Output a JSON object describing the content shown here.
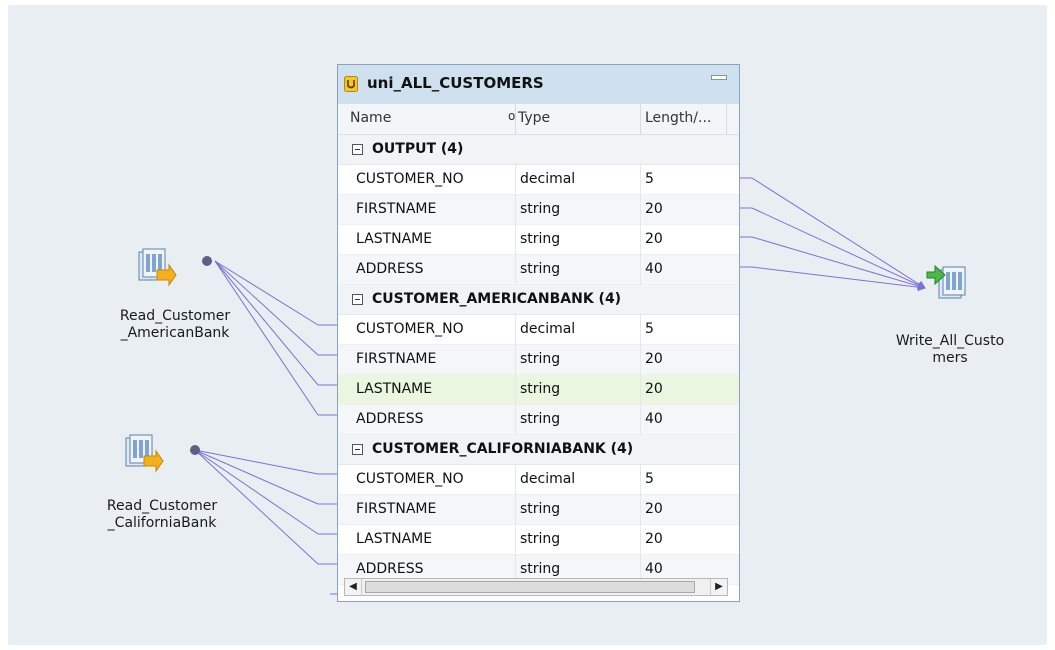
{
  "canvas": {
    "background": "#e9eef2",
    "link_color": "#7b72d8"
  },
  "sources": [
    {
      "label": "Read_Customer\n_AmericanBank",
      "icon": "read-data-object-icon"
    },
    {
      "label": "Read_Customer\n_CaliforniaBank",
      "icon": "read-data-object-icon"
    }
  ],
  "target": {
    "label": "Write_All_Custo\nmers",
    "icon": "write-data-object-icon"
  },
  "transformation": {
    "title": "uni_ALL_CUSTOMERS",
    "icon": "union-transformation-icon",
    "columns": [
      "Name",
      "Type",
      "Length/..."
    ],
    "groups": [
      {
        "name": "OUTPUT (4)",
        "rows": [
          {
            "name": "CUSTOMER_NO",
            "type": "decimal",
            "length": "5"
          },
          {
            "name": "FIRSTNAME",
            "type": "string",
            "length": "20"
          },
          {
            "name": "LASTNAME",
            "type": "string",
            "length": "20"
          },
          {
            "name": "ADDRESS",
            "type": "string",
            "length": "40"
          }
        ]
      },
      {
        "name": "CUSTOMER_AMERICANBANK (4)",
        "rows": [
          {
            "name": "CUSTOMER_NO",
            "type": "decimal",
            "length": "5"
          },
          {
            "name": "FIRSTNAME",
            "type": "string",
            "length": "20"
          },
          {
            "name": "LASTNAME",
            "type": "string",
            "length": "20"
          },
          {
            "name": "ADDRESS",
            "type": "string",
            "length": "40"
          }
        ]
      },
      {
        "name": "CUSTOMER_CALIFORNIABANK (4)",
        "rows": [
          {
            "name": "CUSTOMER_NO",
            "type": "decimal",
            "length": "5"
          },
          {
            "name": "FIRSTNAME",
            "type": "string",
            "length": "20"
          },
          {
            "name": "LASTNAME",
            "type": "string",
            "length": "20"
          },
          {
            "name": "ADDRESS",
            "type": "string",
            "length": "40"
          }
        ]
      }
    ]
  }
}
